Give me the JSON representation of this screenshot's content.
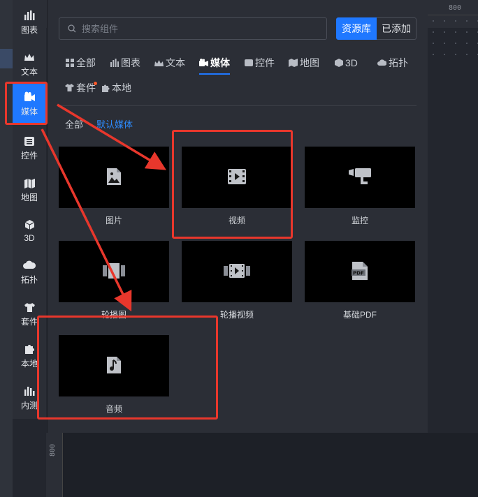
{
  "rail": {
    "items": [
      {
        "label": "图表",
        "icon": "bar-chart-icon"
      },
      {
        "label": "文本",
        "icon": "crown-text-icon"
      },
      {
        "label": "媒体",
        "icon": "media-camera-icon",
        "active": true
      },
      {
        "label": "控件",
        "icon": "control-list-icon"
      },
      {
        "label": "地图",
        "icon": "map-icon"
      },
      {
        "label": "3D",
        "icon": "cube-icon"
      },
      {
        "label": "拓扑",
        "icon": "cloud-topology-icon"
      },
      {
        "label": "套件",
        "icon": "shirt-kit-icon"
      },
      {
        "label": "本地",
        "icon": "puzzle-icon"
      },
      {
        "label": "内测",
        "icon": "bar-chart-beta-icon"
      }
    ]
  },
  "search": {
    "placeholder": "搜索组件"
  },
  "source_buttons": {
    "library": "资源库",
    "added": "已添加"
  },
  "tabs": [
    {
      "label": "全部",
      "icon": "grid-icon"
    },
    {
      "label": "图表",
      "icon": "bar-chart-icon"
    },
    {
      "label": "文本",
      "icon": "crown-text-icon"
    },
    {
      "label": "媒体",
      "icon": "media-camera-icon",
      "active": true
    },
    {
      "label": "控件",
      "icon": "control-icon"
    },
    {
      "label": "地图",
      "icon": "map-icon"
    },
    {
      "label": "3D",
      "icon": "cube-icon"
    },
    {
      "label": "拓扑",
      "icon": "cloud-topology-icon"
    },
    {
      "label": "套件",
      "icon": "shirt-kit-icon",
      "badge": true
    },
    {
      "label": "本地",
      "icon": "puzzle-icon"
    }
  ],
  "subtabs": {
    "all": "全部",
    "default_media": "默认媒体"
  },
  "cards": [
    {
      "label": "图片",
      "icon": "image-file-icon"
    },
    {
      "label": "视频",
      "icon": "film-play-icon"
    },
    {
      "label": "监控",
      "icon": "cctv-camera-icon"
    },
    {
      "label": "轮播图",
      "icon": "carousel-icon"
    },
    {
      "label": "轮播视频",
      "icon": "carousel-video-icon"
    },
    {
      "label": "基础PDF",
      "icon": "pdf-file-icon"
    },
    {
      "label": "音频",
      "icon": "audio-file-icon"
    }
  ],
  "ruler": {
    "top_value": "800",
    "left_value": "800"
  },
  "colors": {
    "accent": "#1f78ff",
    "annotation": "#e8372c",
    "badge": "#ff5a2a"
  }
}
